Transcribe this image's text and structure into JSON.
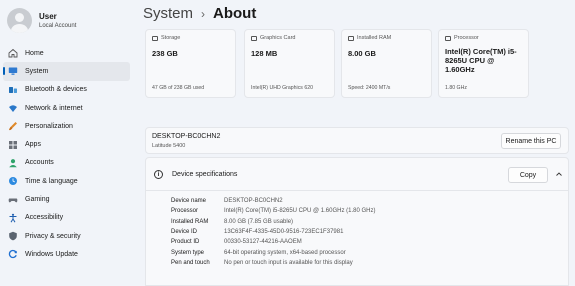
{
  "user": {
    "name": "User",
    "account": "Local Account"
  },
  "nav": [
    {
      "label": "Home",
      "icon": "home-icon"
    },
    {
      "label": "System",
      "icon": "monitor-icon",
      "active": true
    },
    {
      "label": "Bluetooth & devices",
      "icon": "bluetooth-icon"
    },
    {
      "label": "Network & internet",
      "icon": "wifi-icon"
    },
    {
      "label": "Personalization",
      "icon": "brush-icon"
    },
    {
      "label": "Apps",
      "icon": "apps-icon"
    },
    {
      "label": "Accounts",
      "icon": "person-icon"
    },
    {
      "label": "Time & language",
      "icon": "globe-clock-icon"
    },
    {
      "label": "Gaming",
      "icon": "gamepad-icon"
    },
    {
      "label": "Accessibility",
      "icon": "accessibility-icon"
    },
    {
      "label": "Privacy & security",
      "icon": "shield-icon"
    },
    {
      "label": "Windows Update",
      "icon": "update-icon"
    }
  ],
  "breadcrumb": {
    "parent": "System",
    "separator": "›",
    "current": "About"
  },
  "cards": [
    {
      "title": "Storage",
      "value": "238 GB",
      "sub": "47 GB of 238 GB used",
      "icon": "storage-icon"
    },
    {
      "title": "Graphics Card",
      "value": "128 MB",
      "sub": "Intel(R) UHD Graphics 620",
      "icon": "graphics-card-icon"
    },
    {
      "title": "Installed RAM",
      "value": "8.00 GB",
      "sub": "Speed: 2400 MT/s",
      "icon": "ram-icon"
    },
    {
      "title": "Processor",
      "value": "Intel(R) Core(TM) i5-8265U CPU @ 1.60GHz",
      "sub": "1.80 GHz",
      "icon": "processor-icon"
    }
  ],
  "pc": {
    "name": "DESKTOP-BC0CHN2",
    "model": "Latitude 5400",
    "rename_label": "Rename this PC"
  },
  "specs": {
    "title": "Device specifications",
    "copy_label": "Copy",
    "rows": [
      {
        "label": "Device name",
        "value": "DESKTOP-BC0CHN2"
      },
      {
        "label": "Processor",
        "value": "Intel(R) Core(TM) i5-8265U CPU @ 1.60GHz (1.80 GHz)"
      },
      {
        "label": "Installed RAM",
        "value": "8.00 GB (7.85 GB usable)"
      },
      {
        "label": "Device ID",
        "value": "13C63F4F-4335-45D0-9516-723EC1F37981"
      },
      {
        "label": "Product ID",
        "value": "00330-53127-44216-AAOEM"
      },
      {
        "label": "System type",
        "value": "64-bit operating system, x64-based processor"
      },
      {
        "label": "Pen and touch",
        "value": "No pen or touch input is available for this display"
      }
    ]
  },
  "colors": {
    "accent": "#005fb8",
    "background": "#f1f4f9",
    "card": "#f8f9fb"
  }
}
